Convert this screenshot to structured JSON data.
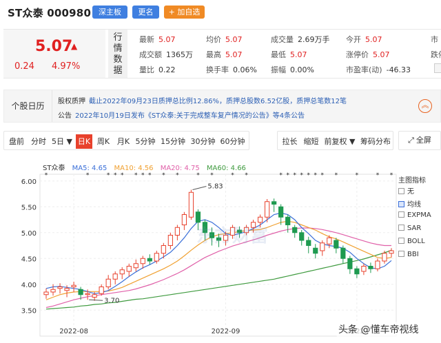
{
  "header": {
    "title": "ST众泰 000980",
    "board_button": "深主板",
    "more_button": "更名",
    "add_button": "+ 加自选"
  },
  "quote": {
    "price": "5.07",
    "change": "0.24",
    "change_pct": "4.97%",
    "section_label": "行情数据",
    "rows": [
      [
        {
          "k": "最新",
          "v": "5.07",
          "red": true
        },
        {
          "k": "均价",
          "v": "5.07",
          "red": true
        },
        {
          "k": "成交量",
          "v": "2.69万手",
          "red": false
        },
        {
          "k": "今开",
          "v": "5.07",
          "red": true
        },
        {
          "k": "市",
          "v": "",
          "red": false
        }
      ],
      [
        {
          "k": "成交额",
          "v": "1365万",
          "red": false
        },
        {
          "k": "最高",
          "v": "5.07",
          "red": true
        },
        {
          "k": "最低",
          "v": "5.07",
          "red": true
        },
        {
          "k": "涨停价",
          "v": "5.07",
          "red": true
        },
        {
          "k": "跌停",
          "v": "",
          "red": false
        }
      ],
      [
        {
          "k": "量比",
          "v": "0.22",
          "red": false
        },
        {
          "k": "换手率",
          "v": "0.06%",
          "red": false
        },
        {
          "k": "振幅",
          "v": "0.00%",
          "red": false
        },
        {
          "k": "市盈率(动)",
          "v": "-46.33",
          "red": false
        },
        {
          "k": "",
          "v": "",
          "red": false
        }
      ]
    ]
  },
  "announcement": {
    "title": "个股日历",
    "line1_label": "股权质押",
    "line1_text": "截止2022年09月23日质押总比例12.86%，质押总股数6.52亿股，质押总笔数12笔",
    "line2_label": "公告",
    "line2_text": "2022年10月19日发布《ST众泰:关于完成整车复产情况的公告》等4条公告"
  },
  "tabs": {
    "left": [
      "盘前",
      "分时",
      "5日 ▼",
      "日K",
      "周K",
      "月K",
      "5分钟",
      "15分钟",
      "30分钟",
      "60分钟"
    ],
    "active_index": 3,
    "right": [
      "拉长",
      "缩短",
      "前复权 ▼",
      "筹码分布"
    ],
    "fullscreen": "全屏"
  },
  "chart": {
    "stock_name": "ST众泰",
    "ma_labels": [
      {
        "text": "MA5: 4.65",
        "color": "#3a6fd8"
      },
      {
        "text": "MA10: 4.56",
        "color": "#f0a030"
      },
      {
        "text": "MA20: 4.75",
        "color": "#e05fa8"
      },
      {
        "text": "MA60: 4.66",
        "color": "#3e9a3e"
      }
    ],
    "logo_text": "东方财富",
    "indicators_title": "主图指标",
    "indicators": [
      {
        "label": "无",
        "checked": false
      },
      {
        "label": "均线",
        "checked": true
      },
      {
        "label": "EXPMA",
        "checked": false
      },
      {
        "label": "SAR",
        "checked": false
      },
      {
        "label": "BOLL",
        "checked": false
      },
      {
        "label": "BBI",
        "checked": false
      }
    ],
    "watermark": "头条 @懂车帝视线"
  },
  "chart_data": {
    "type": "candlestick",
    "y_ticks": [
      "6.00",
      "5.50",
      "5.00",
      "4.50",
      "4.00",
      "3.50"
    ],
    "ylim": [
      3.45,
      6.05
    ],
    "x_ticks": [
      {
        "label": "2022-08",
        "index": 4
      },
      {
        "label": "2022-09",
        "index": 26
      },
      {
        "label": "2022-",
        "index": 45
      }
    ],
    "annotations": [
      {
        "text": "5.83",
        "index": 21,
        "value": 5.83
      },
      {
        "text": "3.70",
        "index": 6,
        "value": 3.7
      }
    ],
    "ohlc": [
      [
        3.8,
        3.85,
        3.75,
        3.72,
        3.92
      ],
      [
        3.85,
        3.9,
        3.8,
        3.78,
        4.0
      ],
      [
        3.92,
        3.95,
        3.85,
        3.82,
        4.02
      ],
      [
        3.88,
        3.92,
        3.8,
        3.75,
        3.98
      ],
      [
        3.95,
        3.98,
        3.9,
        3.85,
        4.05
      ],
      [
        3.9,
        3.8,
        3.75,
        3.7,
        3.95
      ],
      [
        3.8,
        3.82,
        3.72,
        3.7,
        3.9
      ],
      [
        3.75,
        3.8,
        3.7,
        3.68,
        3.85
      ],
      [
        3.82,
        3.95,
        3.8,
        3.78,
        4.0
      ],
      [
        3.95,
        4.1,
        3.92,
        3.9,
        4.18
      ],
      [
        4.1,
        4.2,
        4.05,
        4.0,
        4.25
      ],
      [
        4.2,
        4.28,
        4.15,
        4.1,
        4.33
      ],
      [
        4.25,
        4.35,
        4.2,
        4.15,
        4.4
      ],
      [
        4.32,
        4.4,
        4.28,
        4.25,
        4.48
      ],
      [
        4.4,
        4.5,
        4.35,
        4.3,
        4.55
      ],
      [
        4.5,
        4.45,
        4.4,
        4.38,
        4.58
      ],
      [
        4.45,
        4.6,
        4.42,
        4.4,
        4.65
      ],
      [
        4.6,
        4.75,
        4.55,
        4.5,
        4.8
      ],
      [
        4.75,
        4.95,
        4.7,
        4.68,
        5.0
      ],
      [
        4.95,
        5.1,
        4.9,
        4.85,
        5.15
      ],
      [
        5.15,
        5.35,
        5.1,
        5.05,
        5.4
      ],
      [
        5.3,
        5.78,
        5.28,
        5.25,
        5.83
      ],
      [
        5.4,
        5.2,
        5.1,
        5.05,
        5.45
      ],
      [
        5.2,
        5.0,
        4.9,
        4.85,
        5.25
      ],
      [
        5.0,
        4.9,
        4.85,
        4.75,
        5.1
      ],
      [
        4.9,
        4.85,
        4.8,
        4.72,
        4.98
      ],
      [
        4.85,
        4.95,
        4.8,
        4.75,
        5.02
      ],
      [
        4.95,
        5.1,
        4.9,
        4.88,
        5.15
      ],
      [
        5.05,
        5.0,
        4.95,
        4.9,
        5.12
      ],
      [
        5.0,
        5.1,
        4.98,
        4.95,
        5.15
      ],
      [
        5.1,
        5.2,
        5.05,
        5.0,
        5.25
      ],
      [
        5.2,
        5.3,
        5.15,
        5.1,
        5.35
      ],
      [
        5.3,
        5.6,
        5.25,
        5.2,
        5.65
      ],
      [
        5.6,
        5.55,
        5.45,
        5.4,
        5.66
      ],
      [
        5.5,
        5.3,
        5.2,
        5.15,
        5.55
      ],
      [
        5.3,
        5.15,
        5.05,
        5.0,
        5.35
      ],
      [
        5.1,
        5.0,
        4.95,
        4.9,
        5.15
      ],
      [
        5.0,
        4.85,
        4.8,
        4.75,
        5.05
      ],
      [
        4.85,
        4.75,
        4.65,
        4.6,
        4.92
      ],
      [
        4.7,
        4.6,
        4.55,
        4.5,
        4.78
      ],
      [
        4.65,
        4.8,
        4.6,
        4.55,
        4.85
      ],
      [
        4.78,
        4.9,
        4.75,
        4.7,
        4.95
      ],
      [
        4.85,
        4.7,
        4.65,
        4.6,
        4.9
      ],
      [
        4.7,
        4.5,
        4.45,
        4.4,
        4.75
      ],
      [
        4.5,
        4.3,
        4.25,
        4.2,
        4.55
      ],
      [
        4.3,
        4.2,
        4.15,
        4.12,
        4.35
      ],
      [
        4.25,
        4.35,
        4.22,
        4.18,
        4.4
      ],
      [
        4.35,
        4.3,
        4.25,
        4.22,
        4.42
      ],
      [
        4.3,
        4.45,
        4.28,
        4.25,
        4.5
      ],
      [
        4.45,
        4.6,
        4.42,
        4.4,
        4.65
      ],
      [
        4.6,
        4.65,
        4.55,
        4.52,
        4.7
      ]
    ],
    "ma5": [
      3.92,
      3.95,
      3.96,
      3.94,
      3.92,
      3.9,
      3.86,
      3.82,
      3.84,
      3.88,
      3.96,
      4.05,
      4.15,
      4.24,
      4.32,
      4.38,
      4.45,
      4.53,
      4.62,
      4.75,
      4.9,
      5.08,
      5.22,
      5.25,
      5.2,
      5.1,
      4.98,
      4.95,
      4.98,
      5.02,
      5.08,
      5.15,
      5.25,
      5.35,
      5.38,
      5.35,
      5.25,
      5.1,
      4.98,
      4.85,
      4.78,
      4.75,
      4.73,
      4.7,
      4.62,
      4.5,
      4.4,
      4.32,
      4.3,
      4.35,
      4.46
    ],
    "ma10": [
      3.7,
      3.75,
      3.8,
      3.83,
      3.85,
      3.86,
      3.86,
      3.86,
      3.86,
      3.87,
      3.9,
      3.94,
      4.0,
      4.06,
      4.12,
      4.18,
      4.24,
      4.3,
      4.37,
      4.45,
      4.55,
      4.66,
      4.76,
      4.85,
      4.92,
      4.96,
      4.98,
      5.0,
      5.02,
      5.04,
      5.05,
      5.06,
      5.1,
      5.15,
      5.2,
      5.22,
      5.2,
      5.15,
      5.1,
      5.05,
      4.98,
      4.92,
      4.88,
      4.82,
      4.76,
      4.7,
      4.64,
      4.58,
      4.52,
      4.5,
      4.52
    ],
    "ma20": [
      3.55,
      3.58,
      3.62,
      3.66,
      3.7,
      3.73,
      3.76,
      3.78,
      3.8,
      3.82,
      3.84,
      3.86,
      3.88,
      3.91,
      3.95,
      3.99,
      4.04,
      4.09,
      4.15,
      4.21,
      4.28,
      4.36,
      4.44,
      4.52,
      4.58,
      4.64,
      4.69,
      4.74,
      4.78,
      4.82,
      4.86,
      4.9,
      4.95,
      4.99,
      5.03,
      5.06,
      5.08,
      5.09,
      5.09,
      5.08,
      5.06,
      5.03,
      5.0,
      4.96,
      4.92,
      4.88,
      4.84,
      4.8,
      4.77,
      4.75,
      4.75
    ],
    "ma60": [
      3.52,
      3.53,
      3.54,
      3.55,
      3.56,
      3.58,
      3.59,
      3.61,
      3.62,
      3.64,
      3.65,
      3.67,
      3.69,
      3.71,
      3.72,
      3.74,
      3.76,
      3.78,
      3.8,
      3.82,
      3.84,
      3.86,
      3.88,
      3.9,
      3.92,
      3.94,
      3.96,
      3.98,
      4.0,
      4.02,
      4.04,
      4.06,
      4.08,
      4.1,
      4.13,
      4.16,
      4.19,
      4.22,
      4.25,
      4.28,
      4.31,
      4.34,
      4.37,
      4.4,
      4.43,
      4.46,
      4.49,
      4.53,
      4.57,
      4.61,
      4.66
    ]
  }
}
